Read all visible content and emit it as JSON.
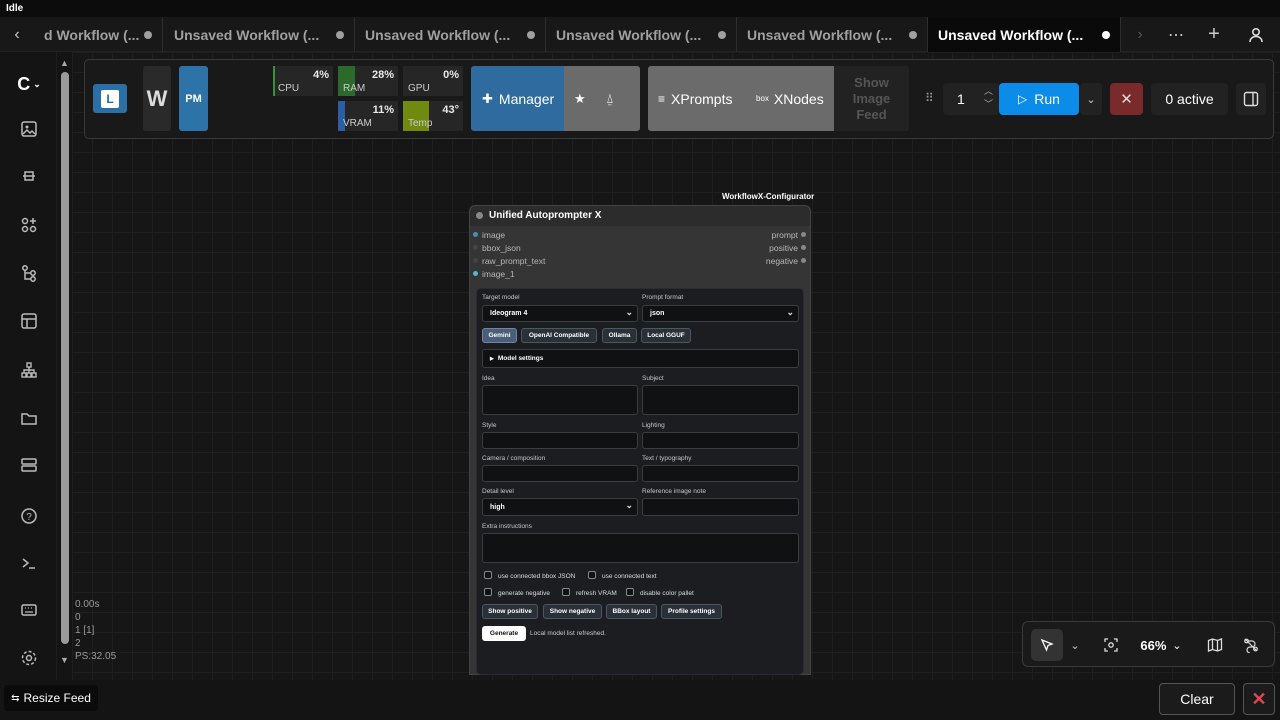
{
  "status": "Idle",
  "tabs": [
    {
      "label": "d Workflow (..."
    },
    {
      "label": "Unsaved Workflow (..."
    },
    {
      "label": "Unsaved Workflow (..."
    },
    {
      "label": "Unsaved Workflow (..."
    },
    {
      "label": "Unsaved Workflow (..."
    },
    {
      "label": "Unsaved Workflow (..."
    }
  ],
  "toolbar": {
    "w_label": "W",
    "pm_label": "PM",
    "monitors": {
      "cpu": {
        "label": "CPU",
        "value": "4%"
      },
      "ram": {
        "label": "RAM",
        "value": "28%"
      },
      "gpu": {
        "label": "GPU",
        "value": "0%"
      },
      "vram": {
        "label": "VRAM",
        "value": "11%"
      },
      "temp": {
        "label": "Temp",
        "value": "43°"
      }
    },
    "manager_label": "Manager",
    "xprompts_label": "XPrompts",
    "xnodes_label": "XNodes",
    "show_image_feed_label": "Show Image Feed",
    "batch_count": "1",
    "run_label": "Run",
    "active_label": "0 active"
  },
  "node": {
    "group_label": "WorkflowX-Configurator",
    "title": "Unified Autoprompter X",
    "inputs": [
      "image",
      "bbox_json",
      "raw_prompt_text",
      "image_1"
    ],
    "outputs": [
      "prompt",
      "positive",
      "negative"
    ],
    "form": {
      "target_model_label": "Target model",
      "target_model_value": "Ideogram 4",
      "prompt_format_label": "Prompt format",
      "prompt_format_value": "json",
      "providers": [
        "Gemini",
        "OpenAI Compatible",
        "Ollama",
        "Local GGUF"
      ],
      "model_settings_label": "Model settings",
      "idea_label": "Idea",
      "subject_label": "Subject",
      "style_label": "Style",
      "lighting_label": "Lighting",
      "camera_label": "Camera / composition",
      "text_label": "Text / typography",
      "detail_label": "Detail level",
      "detail_value": "high",
      "reference_label": "Reference image note",
      "extra_label": "Extra instructions",
      "checks": [
        "use connected bbox JSON",
        "use connected text",
        "generate negative",
        "refresh VRAM",
        "disable color pallet"
      ],
      "buttons": [
        "Show positive",
        "Show negative",
        "BBox layout",
        "Profile settings"
      ],
      "generate_label": "Generate",
      "status_text": "Local model list refreshed."
    }
  },
  "stats": [
    "0.00s",
    "0",
    "1 [1]",
    "2",
    "PS:32.05"
  ],
  "zoom": "66%",
  "resize_feed_label": "Resize Feed",
  "clear_label": "Clear",
  "colors": {
    "accent": "#0b8ce9",
    "manager": "#2f6b9e",
    "cancel": "#7a2a2a",
    "close": "#d9534f"
  }
}
